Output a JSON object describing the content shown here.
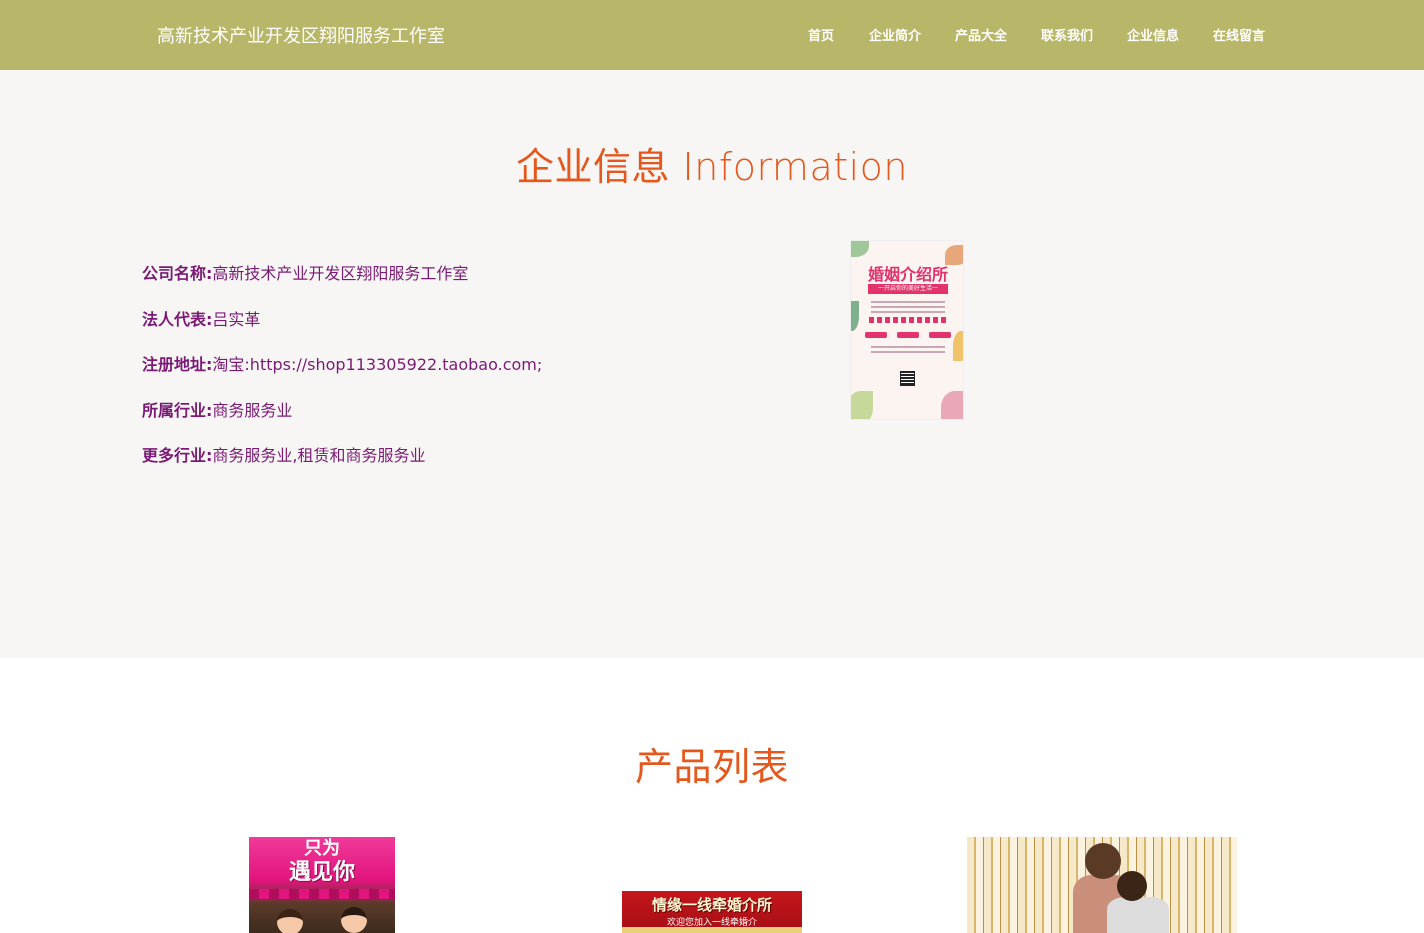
{
  "header": {
    "site_title": "高新技术产业开发区翔阳服务工作室",
    "nav": [
      "首页",
      "企业简介",
      "产品大全",
      "联系我们",
      "企业信息",
      "在线留言"
    ]
  },
  "info": {
    "title": "企业信息 Information",
    "rows": [
      {
        "key": "公司名称:",
        "value": "高新技术产业开发区翔阳服务工作室"
      },
      {
        "key": "法人代表:",
        "value": "吕实革"
      },
      {
        "key": "注册地址:",
        "value": "淘宝:https://shop113305922.taobao.com;"
      },
      {
        "key": "所属行业:",
        "value": "商务服务业"
      },
      {
        "key": "更多行业:",
        "value": "商务服务业,租赁和商务服务业"
      }
    ],
    "poster": {
      "headline": "婚姻介绍所",
      "band": "一开启你的美好生活一"
    }
  },
  "products": {
    "title": "产品列表",
    "items": [
      {
        "line1": "只为",
        "line2": "遇见你"
      },
      {
        "line1": "情缘一线牵婚介所",
        "line2": "欢迎您加入一线牵婚介"
      },
      {}
    ]
  },
  "colors": {
    "header_bg": "#b8b769",
    "section_title": "#e4571d",
    "info_text": "#7b1a76",
    "info_bg": "#f7f6f4"
  }
}
